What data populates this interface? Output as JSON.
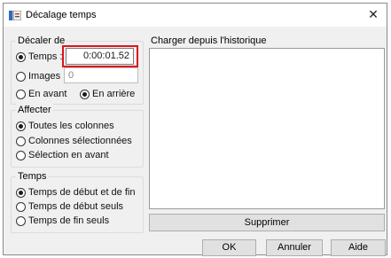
{
  "window": {
    "title": "Décalage temps",
    "close_glyph": "✕"
  },
  "shift_by": {
    "legend": "Décaler de",
    "time_label": "Temps :",
    "time_value": "0:00:01.52",
    "frames_label": "Images :",
    "frames_value": "0",
    "forward_label": "En avant",
    "backward_label": "En arrière"
  },
  "affect": {
    "legend": "Affecter",
    "all_rows_label": "Toutes les colonnes",
    "selected_rows_label": "Colonnes sélectionnées",
    "selection_onward_label": "Sélection en avant"
  },
  "times": {
    "legend": "Temps",
    "start_end_label": "Temps de début et de fin",
    "start_only_label": "Temps de début seuls",
    "end_only_label": "Temps de fin seuls"
  },
  "history": {
    "label": "Charger depuis l'historique",
    "delete_label": "Supprimer"
  },
  "buttons": {
    "ok": "OK",
    "cancel": "Annuler",
    "help": "Aide"
  },
  "colors": {
    "highlight": "#e0141a",
    "dialog_bg": "#f0f0f0"
  }
}
